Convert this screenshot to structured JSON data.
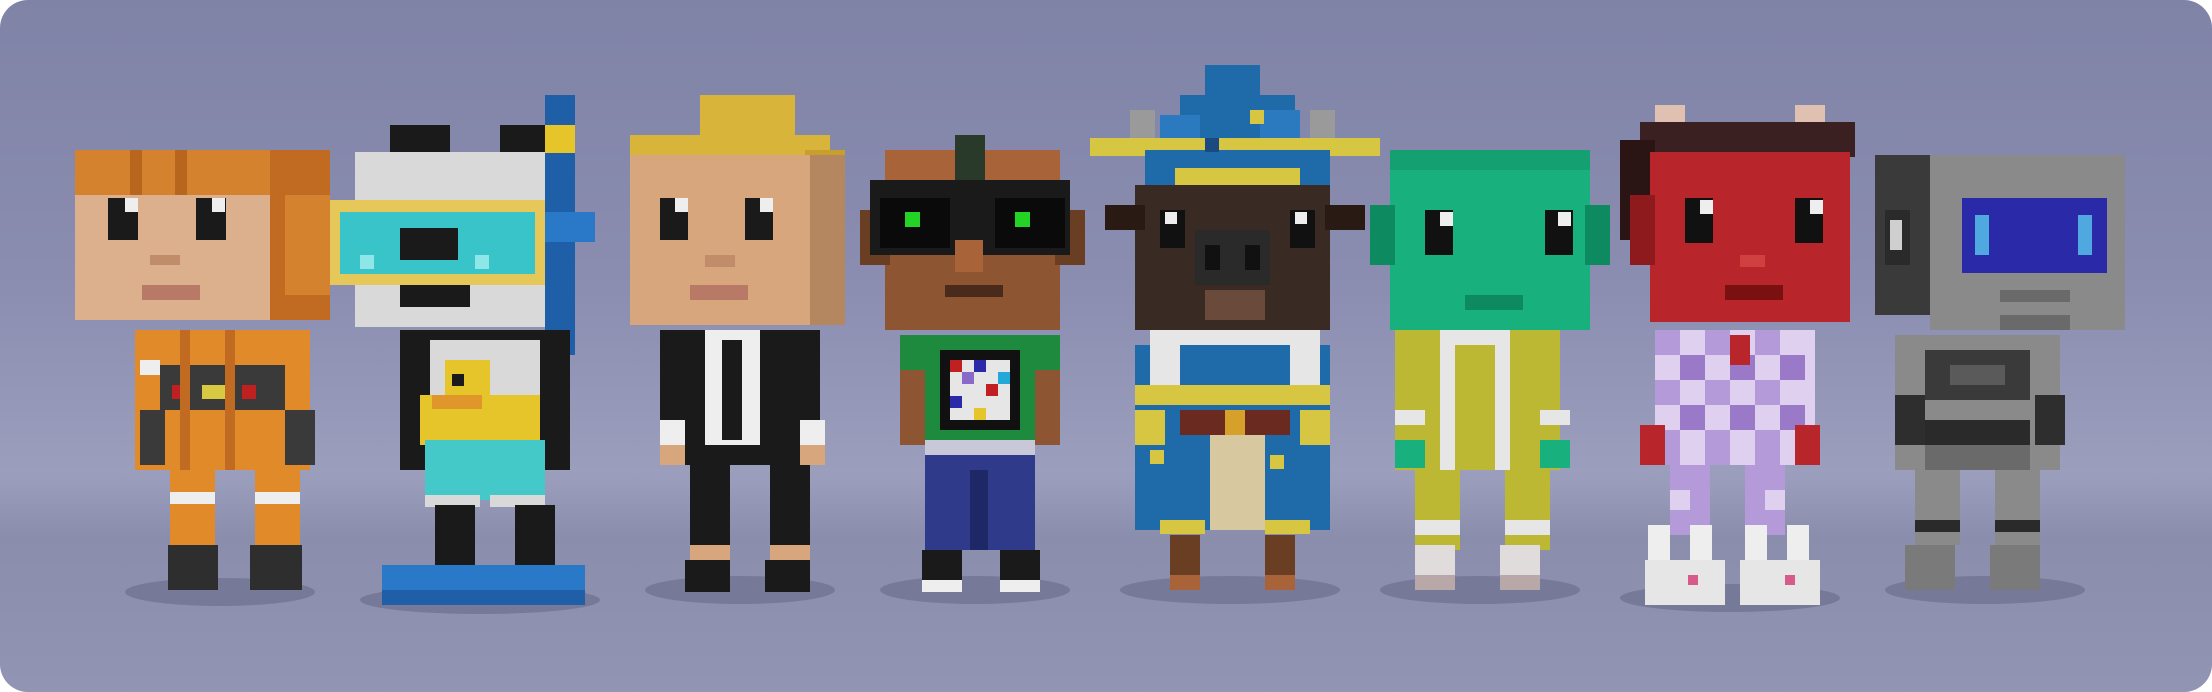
{
  "scene": {
    "subject": "",
    "characters": [
      {
        "id": "orange-hair-kid",
        "palette": {
          "hair": "#d4822e",
          "skin": "#dcb08c",
          "body": "#e08a2a",
          "dark": "#3a3a3a"
        }
      },
      {
        "id": "panda-snorkel",
        "palette": {
          "head": "#d9d9d9",
          "goggles": "#38c4c8",
          "snorkel": "#1e5fa8",
          "duck": "#e6c52a",
          "shorts": "#44c8c8",
          "flippers": "#2a78c8"
        }
      },
      {
        "id": "blond-suit",
        "palette": {
          "hair": "#d8b43a",
          "skin": "#d8a67c",
          "suit": "#1a1a1a",
          "shirt": "#eeeeee"
        }
      },
      {
        "id": "brown-sunglasses",
        "palette": {
          "skin": "#8e5532",
          "glasses": "#111111",
          "lenses": "#24d424",
          "shirt": "#1e8a3e",
          "pants": "#2f3a8a"
        }
      },
      {
        "id": "bison-wizard",
        "palette": {
          "hat": "#1f6aa8",
          "trim": "#d6c642",
          "fur": "#3a2a24",
          "beard": "#e6e6e6",
          "robe": "#1f6aa8"
        }
      },
      {
        "id": "green-alien",
        "palette": {
          "skin": "#18b07c",
          "suit": "#bcb834",
          "shirt": "#e6e6e6"
        }
      },
      {
        "id": "red-devil-pajama",
        "palette": {
          "skin": "#b8252a",
          "hair": "#3a2020",
          "pajama": "#b49ad8",
          "slippers": "#e6e6e6"
        }
      },
      {
        "id": "grey-robot",
        "palette": {
          "body": "#8a8a8a",
          "screen": "#2a2aa8",
          "eyes": "#4fa8e0",
          "dark": "#2e2e2e"
        }
      }
    ]
  }
}
